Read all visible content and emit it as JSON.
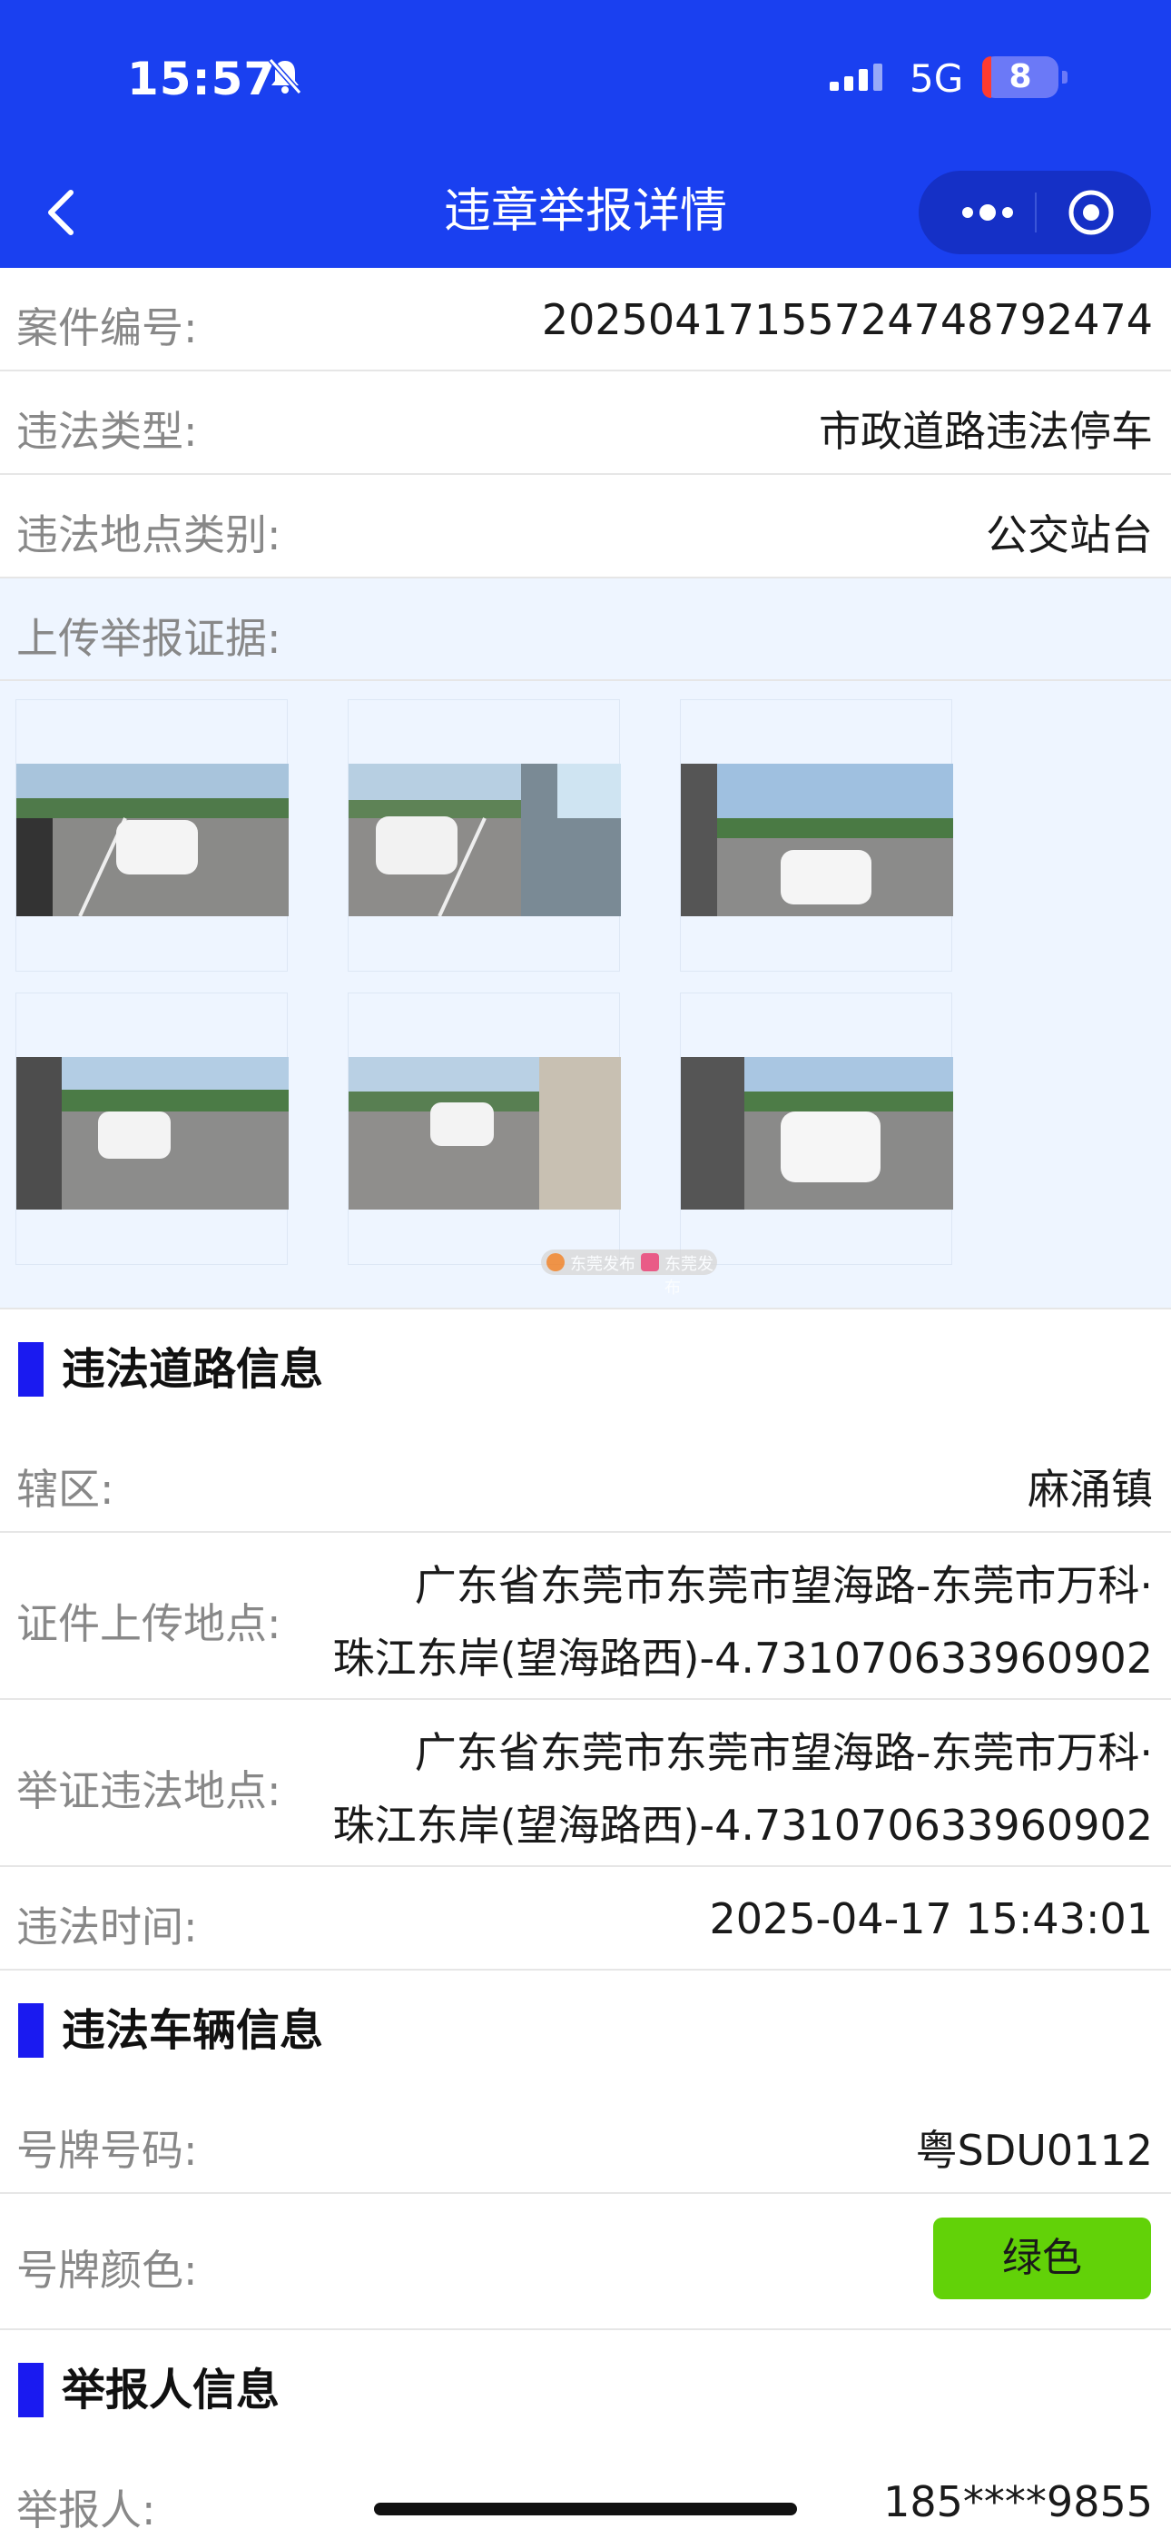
{
  "status": {
    "time": "15:57",
    "network": "5G",
    "battery": "8"
  },
  "nav": {
    "title": "违章举报详情"
  },
  "case": {
    "number_label": "案件编号:",
    "number_value": "20250417155724748792474",
    "type_label": "违法类型:",
    "type_value": "市政道路违法停车",
    "loc_type_label": "违法地点类别:",
    "loc_type_value": "公交站台",
    "evidence_label": "上传举报证据:"
  },
  "watermark": {
    "left": "东莞发布",
    "right": "东莞发布"
  },
  "road": {
    "section_title": "违法道路信息",
    "district_label": "辖区:",
    "district_value": "麻涌镇",
    "upload_loc_label": "证件上传地点:",
    "upload_loc_line1": "广东省东莞市东莞市望海路-东莞市万科·",
    "upload_loc_line2": "珠江东岸(望海路西)-4.731070633960902",
    "evidence_loc_label": "举证违法地点:",
    "evidence_loc_line1": "广东省东莞市东莞市望海路-东莞市万科·",
    "evidence_loc_line2": "珠江东岸(望海路西)-4.731070633960902",
    "time_label": "违法时间:",
    "time_value": "2025-04-17 15:43:01"
  },
  "vehicle": {
    "section_title": "违法车辆信息",
    "plate_label": "号牌号码:",
    "plate_value": "粤SDU0112",
    "color_label": "号牌颜色:",
    "color_value": "绿色"
  },
  "reporter": {
    "section_title": "举报人信息",
    "name_label": "举报人:",
    "name_value": "185****9855"
  },
  "colors": {
    "accent": "#1a40f0",
    "section_bar": "#1a1af0",
    "green_plate": "#62d208"
  }
}
